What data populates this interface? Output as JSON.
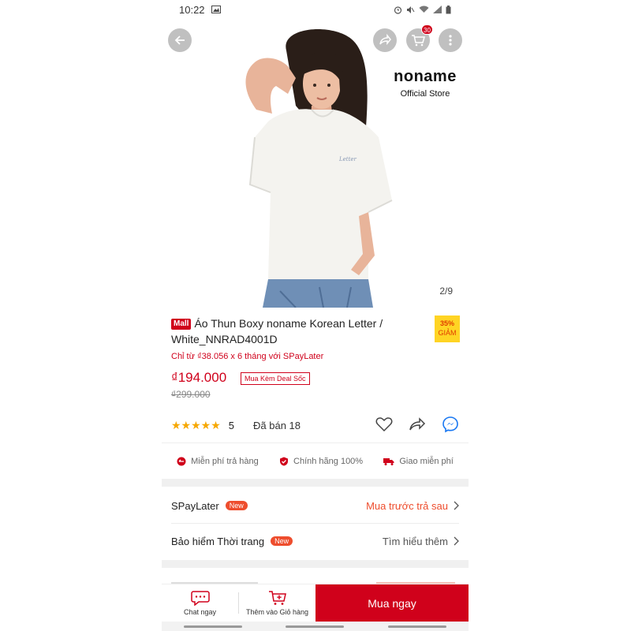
{
  "status_bar": {
    "time": "10:22"
  },
  "hero": {
    "cart_count": "30",
    "brand_name": "noname",
    "brand_sub": "Official Store",
    "pager": "2/9"
  },
  "product": {
    "mall_badge": "Mall",
    "title": "Áo Thun Boxy noname Korean Letter / White_NNRAD4001D",
    "discount_pct": "35%",
    "discount_label": "GIẢM",
    "installment_note": "Chỉ từ ₫38.056 x 6 tháng với SPayLater",
    "price": "₫194.000",
    "deal_tag": "Mua Kèm Deal Sốc",
    "old_price": "₫299.000",
    "stars": "★★★★★",
    "rating": "5",
    "sold": "Đã bán 18"
  },
  "guarantees": [
    {
      "label": "Miễn phí trả hàng",
      "icon": "return-icon"
    },
    {
      "label": "Chính hãng 100%",
      "icon": "shield-icon"
    },
    {
      "label": "Giao miễn phí",
      "icon": "truck-icon"
    }
  ],
  "rows": {
    "spaylater": {
      "label": "SPayLater",
      "badge": "New",
      "action": "Mua trước trả sau"
    },
    "insurance": {
      "label": "Bảo hiểm Thời trang",
      "badge": "New",
      "action": "Tìm hiểu thêm"
    }
  },
  "bottom_bar": {
    "chat": "Chat ngay",
    "add_cart": "Thêm vào Giỏ hàng",
    "buy": "Mua ngay"
  },
  "colors": {
    "primary": "#d0011b",
    "accent": "#ee4d2d",
    "star": "#f6a700",
    "discount_bg": "#ffd424"
  }
}
